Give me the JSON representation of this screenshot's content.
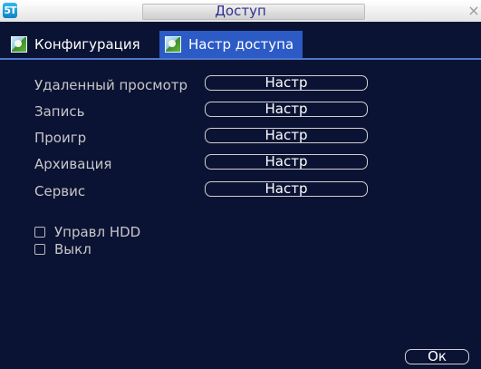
{
  "window": {
    "title": "Доступ",
    "logo_text": "5T",
    "close_glyph": "×"
  },
  "tabs": [
    {
      "label": "Конфигурация",
      "icon": "landscape-icon",
      "active": false
    },
    {
      "label": "Настр доступа",
      "icon": "landscape-icon",
      "active": true
    }
  ],
  "settings": {
    "rows": [
      {
        "label": "Удаленный просмотр",
        "button": "Настр"
      },
      {
        "label": "Запись",
        "button": "Настр"
      },
      {
        "label": "Проигр",
        "button": "Настр"
      },
      {
        "label": "Архивация",
        "button": "Настр"
      },
      {
        "label": "Сервис",
        "button": "Настр"
      }
    ],
    "checkboxes": [
      {
        "label": "Управл HDD",
        "checked": false
      },
      {
        "label": "Выкл",
        "checked": false
      }
    ]
  },
  "footer": {
    "ok_label": "Ок"
  },
  "colors": {
    "background": "#0b1334",
    "accent": "#2c5bc5",
    "title_text": "#303090"
  }
}
